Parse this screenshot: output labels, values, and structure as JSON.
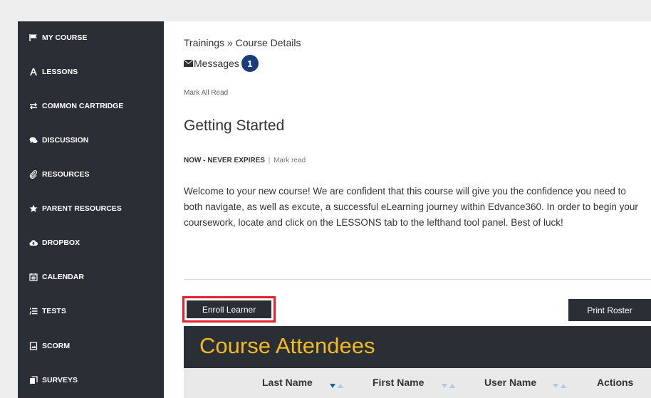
{
  "sidebar": {
    "items": [
      {
        "label": "MY COURSE",
        "icon": "flag-icon"
      },
      {
        "label": "LESSONS",
        "icon": "font-icon"
      },
      {
        "label": "COMMON CARTRIDGE",
        "icon": "exchange-icon"
      },
      {
        "label": "DISCUSSION",
        "icon": "comments-icon"
      },
      {
        "label": "RESOURCES",
        "icon": "paperclip-icon"
      },
      {
        "label": "PARENT RESOURCES",
        "icon": "star-icon"
      },
      {
        "label": "DROPBOX",
        "icon": "cloud-upload-icon"
      },
      {
        "label": "CALENDAR",
        "icon": "calendar-icon"
      },
      {
        "label": "TESTS",
        "icon": "list-ol-icon"
      },
      {
        "label": "SCORM",
        "icon": "file-icon"
      },
      {
        "label": "SURVEYS",
        "icon": "copy-icon"
      }
    ]
  },
  "breadcrumb": {
    "root": "Trainings",
    "separator": "»",
    "current": "Course Details"
  },
  "messages": {
    "label": "Messages",
    "count": "1"
  },
  "mark_all_read": "Mark All Read",
  "announcement": {
    "title": "Getting Started",
    "expires": "NOW - NEVER EXPIRES",
    "separator": "|",
    "mark_read": "Mark read",
    "body": "Welcome to your new course! We are confident that this course will give you the confidence you need to both navigate, as well as excute, a successful eLearning journey within Edvance360. In order to begin your coursework, locate and click on the LESSONS tab to the lefthand tool panel. Best of luck!"
  },
  "buttons": {
    "enroll": "Enroll Learner",
    "print": "Print Roster"
  },
  "attendees": {
    "title": "Course Attendees",
    "columns": [
      "Last Name",
      "First Name",
      "User Name",
      "Actions"
    ]
  },
  "colors": {
    "sidebar_bg": "#2a2e35",
    "accent_title": "#f3b91d",
    "badge": "#1a3d7a",
    "highlight": "#e3202b"
  }
}
